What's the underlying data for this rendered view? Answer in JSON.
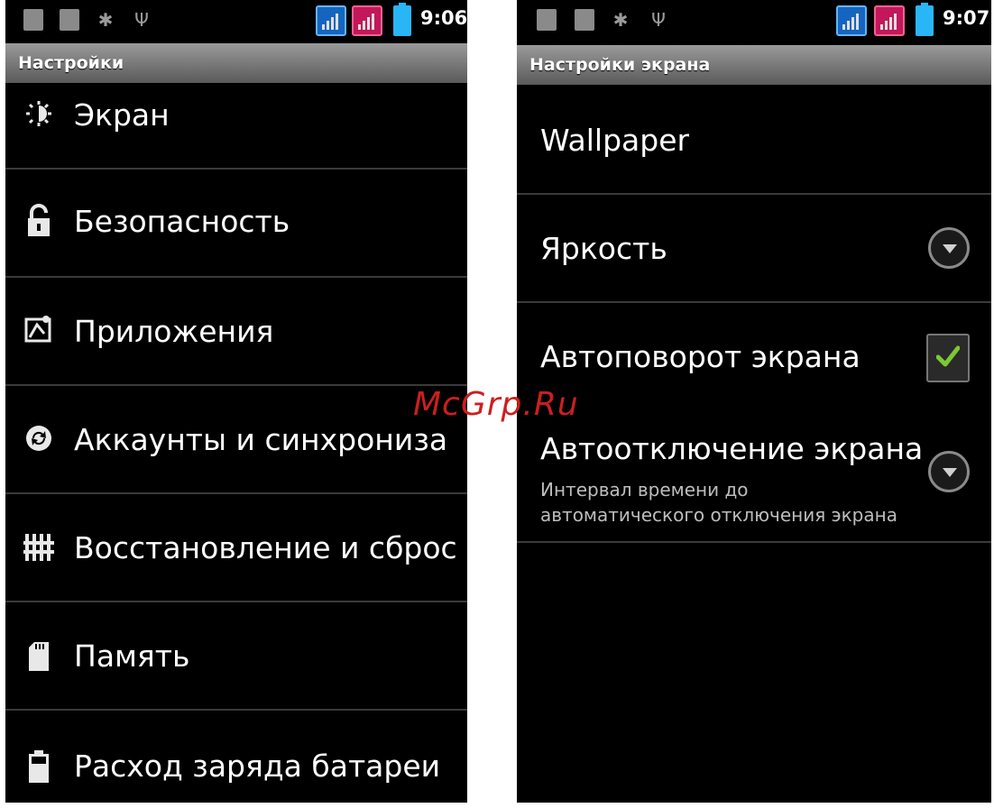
{
  "left": {
    "status": {
      "time": "9:06"
    },
    "title": "Настройки",
    "items": [
      {
        "label": "Экран",
        "icon": "brightness-icon"
      },
      {
        "label": "Безопасность",
        "icon": "lock-icon"
      },
      {
        "label": "Приложения",
        "icon": "apps-icon"
      },
      {
        "label": "Аккаунты и синхронизац",
        "icon": "sync-icon"
      },
      {
        "label": "Восстановление и сброс",
        "icon": "backup-icon"
      },
      {
        "label": "Память",
        "icon": "sdcard-icon"
      },
      {
        "label": "Расход заряда батареи",
        "icon": "battery-icon"
      }
    ]
  },
  "right": {
    "status": {
      "time": "9:07"
    },
    "title": "Настройки экрана",
    "items": [
      {
        "label": "Wallpaper"
      },
      {
        "label": "Яркость",
        "control": "dropdown"
      },
      {
        "label": "Автоповорот экрана",
        "control": "checkbox",
        "checked": true
      },
      {
        "label": "Автоотключение экрана",
        "sub": [
          "Интервал времени до",
          "автоматического отключения экрана"
        ],
        "control": "dropdown"
      }
    ]
  },
  "watermark": "McGrp.Ru",
  "colors": {
    "accent_check": "#7cc832",
    "signal_blue": "#1565c0",
    "signal_pink": "#c2185b",
    "battery": "#29b6f6"
  }
}
